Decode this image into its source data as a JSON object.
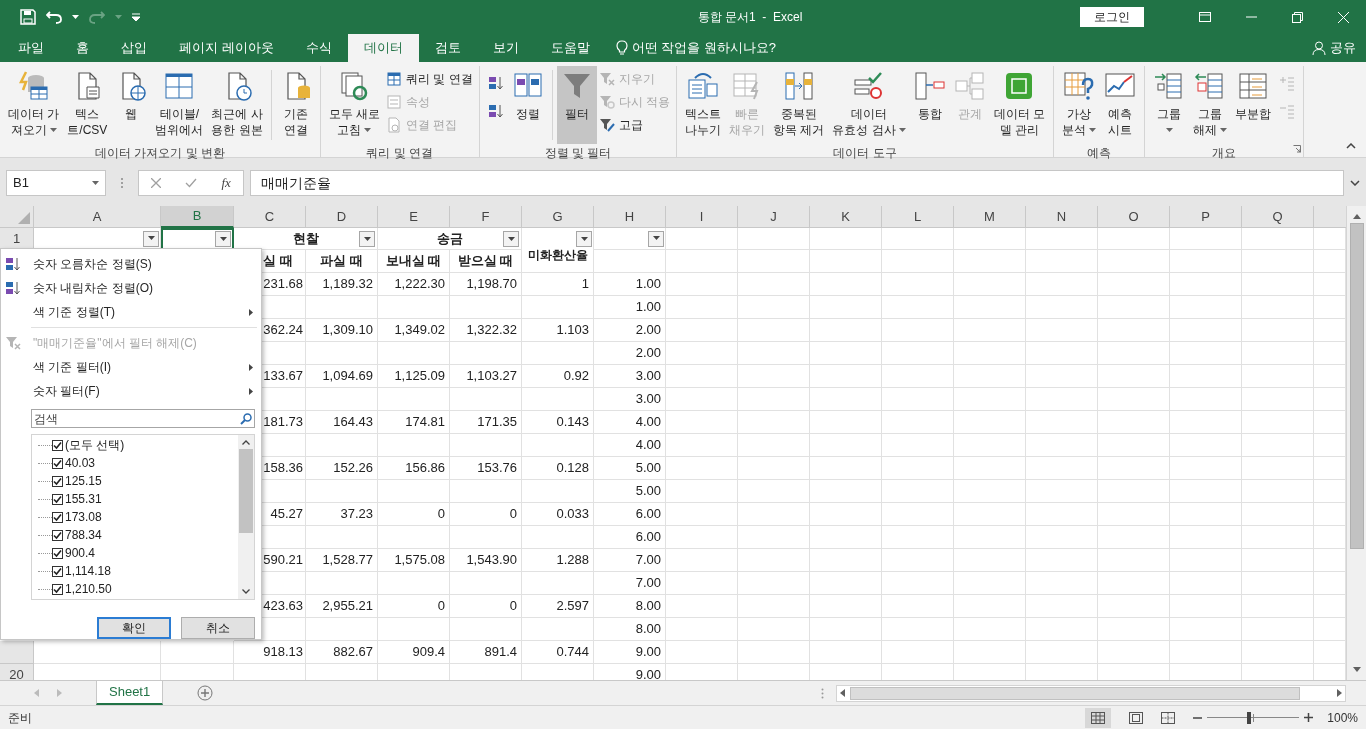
{
  "title_bar": {
    "title": "통합 문서1  -  Excel",
    "login": "로그인"
  },
  "tabs": [
    {
      "label": "파일",
      "selected": false
    },
    {
      "label": "홈",
      "selected": false
    },
    {
      "label": "삽입",
      "selected": false
    },
    {
      "label": "페이지 레이아웃",
      "selected": false
    },
    {
      "label": "수식",
      "selected": false
    },
    {
      "label": "데이터",
      "selected": true
    },
    {
      "label": "검토",
      "selected": false
    },
    {
      "label": "보기",
      "selected": false
    },
    {
      "label": "도움말",
      "selected": false
    }
  ],
  "tell_me": "어떤 작업을 원하시나요?",
  "share": "공유",
  "ribbon": {
    "groups": [
      {
        "label": "데이터 가져오기 및 변환",
        "launcher": false,
        "buttons": [
          {
            "kind": "large",
            "lines": [
              "데이터 가",
              "져오기"
            ],
            "dropdown": true,
            "disabled": false,
            "on": false
          },
          {
            "kind": "large",
            "lines": [
              "텍스",
              "트/CSV"
            ],
            "dropdown": false,
            "disabled": false,
            "on": false
          },
          {
            "kind": "large",
            "lines": [
              "웹"
            ],
            "dropdown": false,
            "disabled": false,
            "on": false
          },
          {
            "kind": "large",
            "lines": [
              "테이블/",
              "범위에서"
            ],
            "dropdown": false,
            "disabled": false,
            "on": false
          },
          {
            "kind": "large",
            "lines": [
              "최근에 사",
              "용한 원본"
            ],
            "dropdown": false,
            "disabled": false,
            "on": false
          },
          {
            "kind": "large",
            "lines": [
              "기존",
              "연결"
            ],
            "dropdown": false,
            "disabled": false,
            "on": false
          }
        ]
      },
      {
        "label": "쿼리 및 연결",
        "launcher": false,
        "buttons": [
          {
            "kind": "large",
            "lines": [
              "모두 새로",
              "고침"
            ],
            "dropdown": true,
            "disabled": false,
            "on": false
          },
          {
            "kind": "small",
            "lines": [
              "쿼리 및 연결"
            ],
            "disabled": false,
            "on": false
          },
          {
            "kind": "small",
            "lines": [
              "속성"
            ],
            "disabled": true,
            "on": false
          },
          {
            "kind": "small",
            "lines": [
              "연결 편집"
            ],
            "disabled": true,
            "on": false
          }
        ]
      },
      {
        "label": "정렬 및 필터",
        "launcher": false,
        "buttons": [
          {
            "kind": "icon",
            "disabled": false,
            "on": false
          },
          {
            "kind": "icon",
            "disabled": false,
            "on": false
          },
          {
            "kind": "large",
            "lines": [
              "정렬"
            ],
            "dropdown": false,
            "disabled": false,
            "on": false
          },
          {
            "kind": "large",
            "lines": [
              "필터"
            ],
            "dropdown": false,
            "disabled": false,
            "on": true
          },
          {
            "kind": "small",
            "lines": [
              "지우기"
            ],
            "disabled": true,
            "on": false
          },
          {
            "kind": "small",
            "lines": [
              "다시 적용"
            ],
            "disabled": true,
            "on": false
          },
          {
            "kind": "small",
            "lines": [
              "고급"
            ],
            "disabled": false,
            "on": false
          }
        ]
      },
      {
        "label": "데이터 도구",
        "launcher": false,
        "buttons": [
          {
            "kind": "large",
            "lines": [
              "텍스트",
              "나누기"
            ],
            "dropdown": false,
            "disabled": false,
            "on": false
          },
          {
            "kind": "large",
            "lines": [
              "빠른",
              "채우기"
            ],
            "dropdown": false,
            "disabled": true,
            "on": false
          },
          {
            "kind": "large",
            "lines": [
              "중복된",
              "항목 제거"
            ],
            "dropdown": false,
            "disabled": false,
            "on": false
          },
          {
            "kind": "large",
            "lines": [
              "데이터",
              "유효성 검사"
            ],
            "dropdown": true,
            "disabled": false,
            "on": false
          },
          {
            "kind": "large",
            "lines": [
              "통합"
            ],
            "dropdown": false,
            "disabled": false,
            "on": false
          },
          {
            "kind": "large",
            "lines": [
              "관계"
            ],
            "dropdown": false,
            "disabled": true,
            "on": false
          },
          {
            "kind": "large",
            "lines": [
              "데이터 모",
              "델 관리"
            ],
            "dropdown": false,
            "disabled": false,
            "on": false
          }
        ]
      },
      {
        "label": "예측",
        "launcher": false,
        "buttons": [
          {
            "kind": "large",
            "lines": [
              "가상",
              "분석"
            ],
            "dropdown": true,
            "disabled": false,
            "on": false
          },
          {
            "kind": "large",
            "lines": [
              "예측",
              "시트"
            ],
            "dropdown": false,
            "disabled": false,
            "on": false
          }
        ]
      },
      {
        "label": "개요",
        "launcher": true,
        "buttons": [
          {
            "kind": "large",
            "lines": [
              "그룹"
            ],
            "dropdown": true,
            "disabled": false,
            "on": false
          },
          {
            "kind": "large",
            "lines": [
              "그룹",
              "해제"
            ],
            "dropdown": true,
            "disabled": false,
            "on": false
          },
          {
            "kind": "large",
            "lines": [
              "부분합"
            ],
            "dropdown": false,
            "disabled": false,
            "on": false
          },
          {
            "kind": "icon",
            "disabled": true,
            "on": false
          },
          {
            "kind": "icon",
            "disabled": true,
            "on": false
          }
        ]
      }
    ]
  },
  "formula_bar": {
    "name_box": "B1",
    "fx": "fx",
    "formula": "매매기준율"
  },
  "columns": [
    {
      "label": "A",
      "selected": false
    },
    {
      "label": "B",
      "selected": true
    },
    {
      "label": "C",
      "selected": false
    },
    {
      "label": "D",
      "selected": false
    },
    {
      "label": "E",
      "selected": false
    },
    {
      "label": "F",
      "selected": false
    },
    {
      "label": "G",
      "selected": false
    },
    {
      "label": "H",
      "selected": false
    },
    {
      "label": "I",
      "selected": false
    },
    {
      "label": "J",
      "selected": false
    },
    {
      "label": "K",
      "selected": false
    },
    {
      "label": "L",
      "selected": false
    },
    {
      "label": "M",
      "selected": false
    },
    {
      "label": "N",
      "selected": false
    },
    {
      "label": "O",
      "selected": false
    },
    {
      "label": "P",
      "selected": false
    },
    {
      "label": "Q",
      "selected": false
    }
  ],
  "sheet": {
    "header": {
      "row_label": "1",
      "groups": [
        "현찰",
        "송금"
      ],
      "subheaders": [
        "실 때",
        "파실 때",
        "보내실 때",
        "받으실 때"
      ],
      "rate": "미화환산율"
    },
    "rows": [
      {
        "kind": "values",
        "cells": [
          "231.68",
          "1,189.32",
          "1,222.30",
          "1,198.70",
          "1",
          "1.00"
        ]
      },
      {
        "kind": "continuation",
        "h": "1.00"
      },
      {
        "kind": "values",
        "cells": [
          "362.24",
          "1,309.10",
          "1,349.02",
          "1,322.32",
          "1.103",
          "2.00"
        ]
      },
      {
        "kind": "continuation",
        "h": "2.00"
      },
      {
        "kind": "values",
        "cells": [
          "133.67",
          "1,094.69",
          "1,125.09",
          "1,103.27",
          "0.92",
          "3.00"
        ]
      },
      {
        "kind": "continuation",
        "h": "3.00"
      },
      {
        "kind": "values",
        "cells": [
          "181.73",
          "164.43",
          "174.81",
          "171.35",
          "0.143",
          "4.00"
        ]
      },
      {
        "kind": "continuation",
        "h": "4.00"
      },
      {
        "kind": "values",
        "cells": [
          "158.36",
          "152.26",
          "156.86",
          "153.76",
          "0.128",
          "5.00"
        ]
      },
      {
        "kind": "continuation",
        "h": "5.00"
      },
      {
        "kind": "values",
        "cells": [
          "45.27",
          "37.23",
          "0",
          "0",
          "0.033",
          "6.00"
        ]
      },
      {
        "kind": "continuation",
        "h": "6.00"
      },
      {
        "kind": "values",
        "cells": [
          "590.21",
          "1,528.77",
          "1,575.08",
          "1,543.90",
          "1.288",
          "7.00"
        ]
      },
      {
        "kind": "continuation",
        "h": "7.00"
      },
      {
        "kind": "values",
        "cells": [
          "423.63",
          "2,955.21",
          "0",
          "0",
          "2.597",
          "8.00"
        ]
      },
      {
        "kind": "continuation",
        "h": "8.00"
      },
      {
        "kind": "values",
        "cells": [
          "918.13",
          "882.67",
          "909.4",
          "891.4",
          "0.744",
          "9.00"
        ]
      },
      {
        "kind": "continuation",
        "h": "9.00",
        "label": "20"
      }
    ]
  },
  "filter_menu": {
    "items": [
      {
        "kind": "sort-asc",
        "label": "숫자 오름차순 정렬(S)",
        "disabled": false
      },
      {
        "kind": "sort-desc",
        "label": "숫자 내림차순 정렬(O)",
        "disabled": false
      },
      {
        "kind": "submenu",
        "label": "색 기준 정렬(T)",
        "disabled": false
      },
      {
        "kind": "clear",
        "label": "\"매매기준율\"에서 필터 해제(C)",
        "disabled": true
      },
      {
        "kind": "submenu",
        "label": "색 기준 필터(I)",
        "disabled": false
      },
      {
        "kind": "submenu",
        "label": "숫자 필터(F)",
        "disabled": false
      }
    ],
    "search_placeholder": "검색",
    "values": [
      {
        "label": "(모두 선택)",
        "checked": true
      },
      {
        "label": "40.03",
        "checked": true
      },
      {
        "label": "125.15",
        "checked": true
      },
      {
        "label": "155.31",
        "checked": true
      },
      {
        "label": "173.08",
        "checked": true
      },
      {
        "label": "788.34",
        "checked": true
      },
      {
        "label": "900.4",
        "checked": true
      },
      {
        "label": "1,114.18",
        "checked": true
      },
      {
        "label": "1,210.50",
        "checked": true
      }
    ],
    "ok": "확인",
    "cancel": "취소"
  },
  "sheet_tabs": [
    {
      "label": "Sheet1",
      "selected": true
    }
  ],
  "status_bar": {
    "status": "준비",
    "zoom": "100%",
    "zoom_slider": {
      "level": 0.45
    }
  }
}
